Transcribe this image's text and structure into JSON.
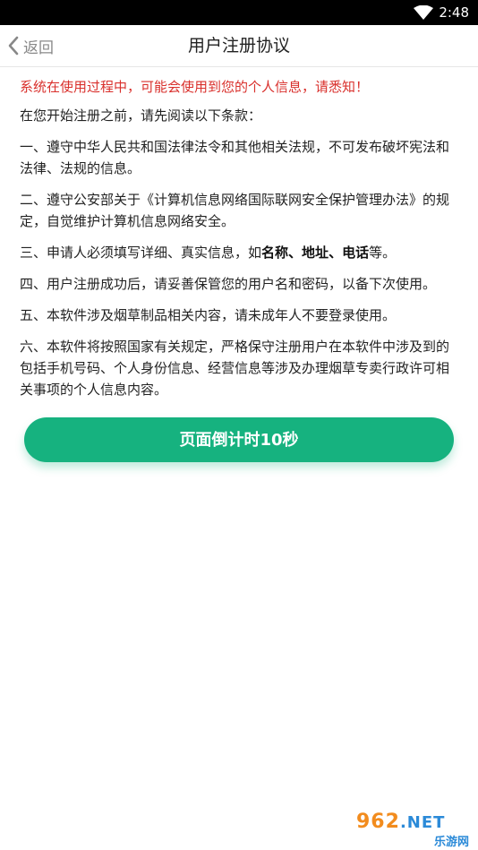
{
  "status_bar": {
    "time": "2:48",
    "wifi_icon": "wifi-icon"
  },
  "nav": {
    "back_label": "返回",
    "back_icon": "chevron-left-icon",
    "title": "用户注册协议"
  },
  "agreement": {
    "warning": "系统在使用过程中，可能会使用到您的个人信息，请悉知！",
    "intro": "在您开始注册之前，请先阅读以下条款：",
    "item1": "一、遵守中华人民共和国法律法令和其他相关法规，不可发布破坏宪法和法律、法规的信息。",
    "item2": "二、遵守公安部关于《计算机信息网络国际联网安全保护管理办法》的规定，自觉维护计算机信息网络安全。",
    "item3_prefix": "三、申请人必须填写详细、真实信息，如",
    "item3_name": "名称",
    "item3_sep1": "、",
    "item3_address": "地址",
    "item3_sep2": "、",
    "item3_phone": "电话",
    "item3_suffix": "等。",
    "item4": "四、用户注册成功后，请妥善保管您的用户名和密码，以备下次使用。",
    "item5": "五、本软件涉及烟草制品相关内容，请未成年人不要登录使用。",
    "item6": "六、本软件将按照国家有关规定，严格保守注册用户在本软件中涉及到的包括手机号码、个人身份信息、经营信息等涉及办理烟草专卖行政许可相关事项的个人信息内容。"
  },
  "countdown_button": {
    "label": "页面倒计时10秒",
    "color": "#16b27f"
  },
  "watermark": {
    "top_digits": "962",
    "top_net": ".NET",
    "bottom": "乐游网"
  },
  "colors": {
    "warning": "#d9302c",
    "accent": "#16b27f"
  }
}
